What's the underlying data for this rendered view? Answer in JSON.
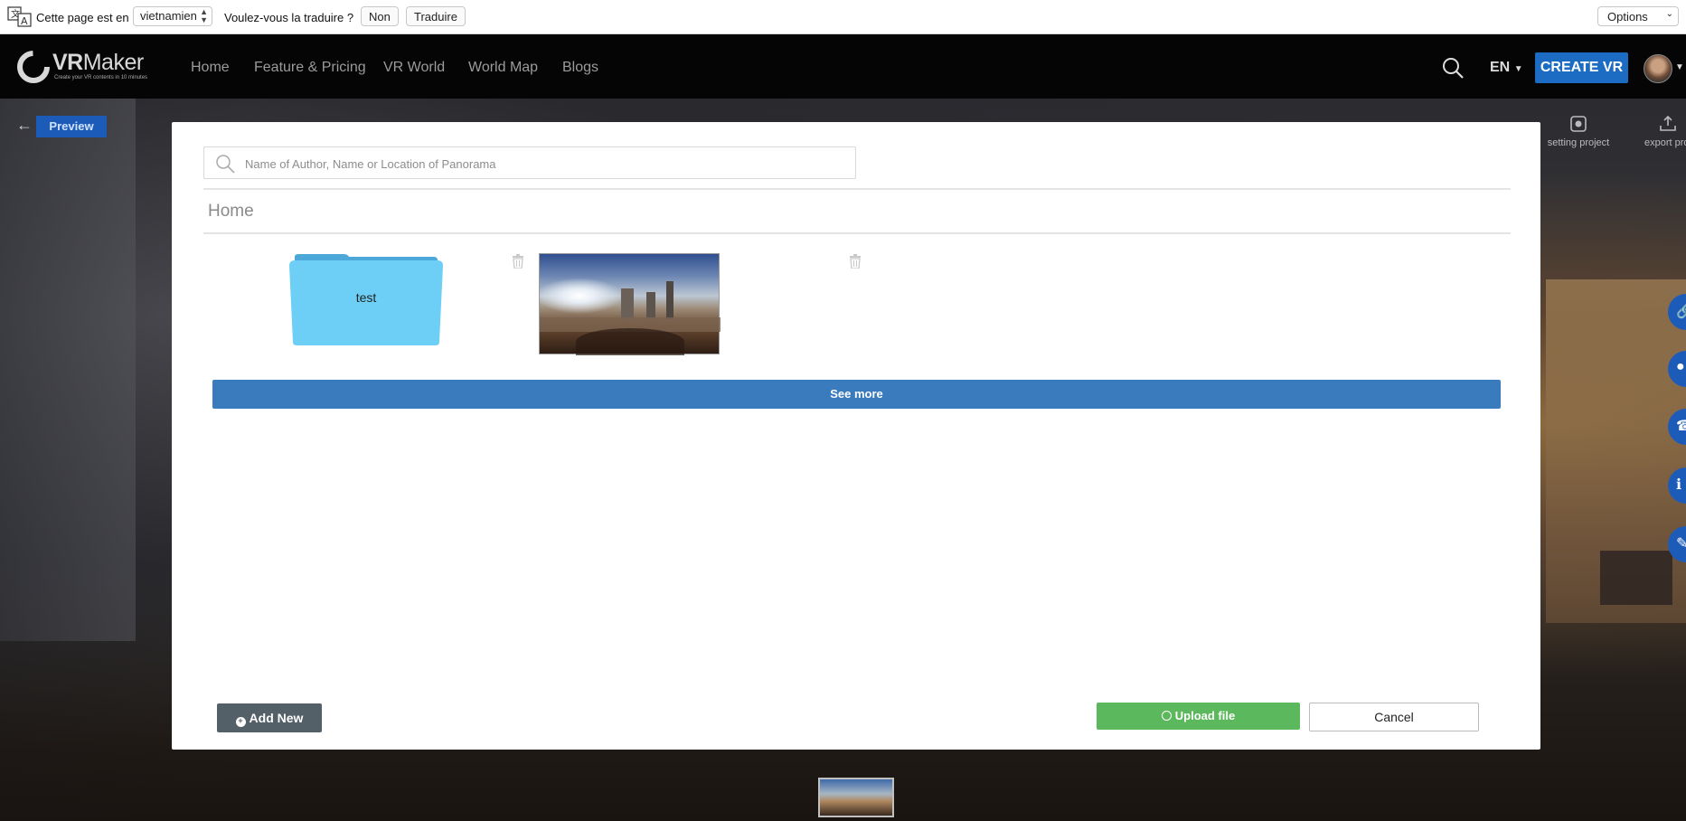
{
  "translate_bar": {
    "prefix": "Cette page est en",
    "language": "vietnamien",
    "question": "Voulez-vous la traduire ?",
    "no_label": "Non",
    "translate_label": "Traduire",
    "options_label": "Options"
  },
  "nav": {
    "logo_text_bold": "VR",
    "logo_text": "Maker",
    "logo_tagline": "Create your VR contents in 10 minutes",
    "items": [
      "Home",
      "Feature & Pricing",
      "VR World",
      "World Map",
      "Blogs"
    ],
    "lang": "EN",
    "create_label": "CREATE VR"
  },
  "editor": {
    "preview_label": "Preview",
    "tools": [
      "setting project",
      "export proj"
    ]
  },
  "modal": {
    "search_placeholder": "Name of Author, Name or Location of Panorama",
    "search_value": "",
    "breadcrumb": "Home",
    "folder_name": "test",
    "see_more_label": "See more",
    "add_new_label": "Add New",
    "upload_label": "Upload file",
    "cancel_label": "Cancel"
  },
  "colors": {
    "primary_blue": "#1c6cc4",
    "see_more_blue": "#3a7bbd",
    "upload_green": "#5cb85c",
    "add_new_gray": "#546068",
    "folder_blue": "#6ecff6"
  }
}
